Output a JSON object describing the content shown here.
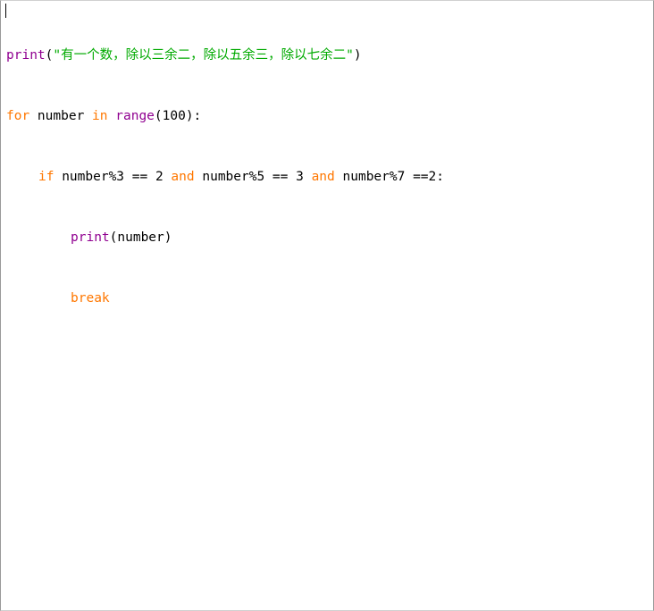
{
  "editor": {
    "lines": [
      {
        "tokens": [
          {
            "text": "print",
            "kind": "builtin"
          },
          {
            "text": "(",
            "kind": "plain"
          },
          {
            "text": "\"有一个数，除以三余二，除以五余三，除以七余二\"",
            "kind": "string"
          },
          {
            "text": ")",
            "kind": "plain"
          }
        ]
      },
      {
        "tokens": [
          {
            "text": "for",
            "kind": "keyword"
          },
          {
            "text": " number ",
            "kind": "plain"
          },
          {
            "text": "in",
            "kind": "keyword"
          },
          {
            "text": " ",
            "kind": "plain"
          },
          {
            "text": "range",
            "kind": "builtin"
          },
          {
            "text": "(100):",
            "kind": "plain"
          }
        ]
      },
      {
        "tokens": [
          {
            "text": "if",
            "kind": "keyword"
          },
          {
            "text": " number%3 == 2 ",
            "kind": "plain"
          },
          {
            "text": "and",
            "kind": "keyword"
          },
          {
            "text": " number%5 == 3 ",
            "kind": "plain"
          },
          {
            "text": "and",
            "kind": "keyword"
          },
          {
            "text": " number%7 ==2:",
            "kind": "plain"
          }
        ]
      },
      {
        "tokens": [
          {
            "text": "print",
            "kind": "builtin"
          },
          {
            "text": "(number)",
            "kind": "plain"
          }
        ]
      },
      {
        "tokens": [
          {
            "text": "break",
            "kind": "keyword"
          }
        ]
      }
    ]
  },
  "colors": {
    "keyword": "#ff7700",
    "builtin": "#900090",
    "string": "#00aa00",
    "plain": "#000000"
  }
}
